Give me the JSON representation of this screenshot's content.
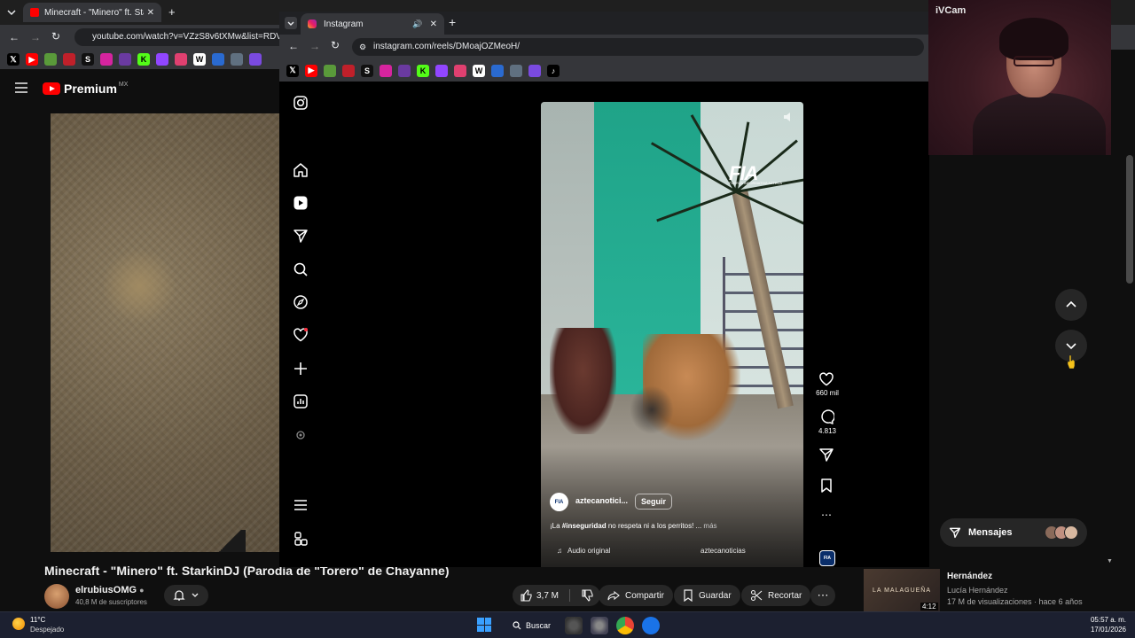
{
  "youtube": {
    "tab_title": "Minecraft - \"Minero\" ft. Starkin",
    "url": "youtube.com/watch?v=VZzS8v6tXMw&list=RDVZz",
    "logo_word": "Premium",
    "logo_region": "MX",
    "video_title": "Minecraft - \"Minero\" ft. StarkinDJ (Parodia de \"Torero\" de Chayanne)",
    "channel_name": "elrubiusOMG",
    "subscribers": "40,8 M de suscriptores",
    "actions": {
      "likes": "3,7 M",
      "share": "Compartir",
      "save": "Guardar",
      "clip": "Recortar"
    },
    "recommended": {
      "thumb_text": "LA MALAGUEÑA",
      "duration": "4:12",
      "title": "Hernández",
      "author": "Lucía Hernández",
      "meta": "17 M de visualizaciones · hace 6 años"
    }
  },
  "instagram": {
    "tab_title": "Instagram",
    "url": "instagram.com/reels/DMoajOZMeoH/",
    "nav_icons": [
      "instagram-logo-icon",
      "home-icon",
      "reels-icon",
      "send-icon",
      "search-icon",
      "explore-icon",
      "heart-icon",
      "create-icon",
      "dashboard-icon",
      "meta-ai-icon",
      "menu-icon",
      "threads-icon"
    ],
    "reel": {
      "logo": "FIA",
      "logo_sub": "FUERZA INFORMATIVA AZTECA",
      "username": "aztecanotici...",
      "follow_label": "Seguir",
      "caption_prefix": "¡La ",
      "caption_hashtag": "#inseguridad",
      "caption_rest": " no respeta ni a los perritos! ...",
      "caption_more": " más",
      "audio_label": "Audio original",
      "audio_tag": "aztecanoticias",
      "likes": "660 mil",
      "comments": "4.813",
      "audio_thumb": "FIA"
    },
    "messages_label": "Mensajes"
  },
  "webcam": {
    "label": "iVCam"
  },
  "taskbar": {
    "temperature": "11°C",
    "condition": "Despejado",
    "search_label": "Buscar",
    "time": "05:57 a. m.",
    "date": "17/01/2026"
  },
  "colors": {
    "youtube_red": "#ff0000",
    "chrome_dark": "#35363a",
    "ig_bg": "#000000",
    "teal_wall": "#1fa388"
  }
}
